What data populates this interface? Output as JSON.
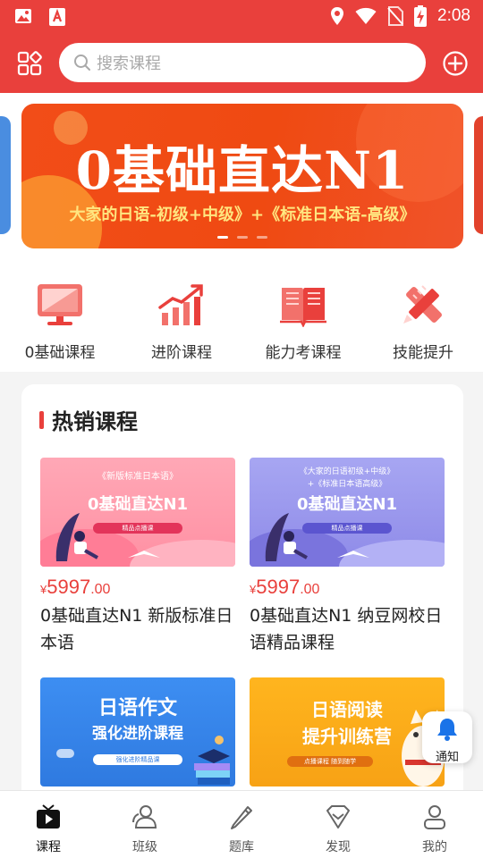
{
  "status_bar": {
    "time": "2:08"
  },
  "header": {
    "search_placeholder": "搜索课程",
    "brand_color": "#e9403c"
  },
  "banner": {
    "title": "0基础直达N1",
    "subtitle": "大家的日语-初级+中级》+《标准日本语-高级》",
    "pages": 3,
    "active_page": 1
  },
  "categories": [
    {
      "label": "0基础课程",
      "icon": "monitor-icon"
    },
    {
      "label": "进阶课程",
      "icon": "growth-chart-icon"
    },
    {
      "label": "能力考课程",
      "icon": "open-book-icon"
    },
    {
      "label": "技能提升",
      "icon": "pencil-ruler-icon"
    }
  ],
  "hot": {
    "title": "热销课程",
    "courses": [
      {
        "thumb_top": "《新版标准日本语》",
        "thumb_title": "0基础直达N1",
        "thumb_pill": "精品点播课",
        "price_currency": "¥",
        "price_int": "5997",
        "price_dec": ".00",
        "name": "0基础直达N1 新版标准日本语"
      },
      {
        "thumb_top": "《大家的日语初级+中级》",
        "thumb_top2": "+《标准日本语高级》",
        "thumb_title": "0基础直达N1",
        "thumb_pill": "精品点播课",
        "price_currency": "¥",
        "price_int": "5997",
        "price_dec": ".00",
        "name": "0基础直达N1 纳豆网校日语精品课程"
      },
      {
        "thumb_title": "日语作文",
        "thumb_title2": "强化进阶课程",
        "thumb_pill": "强化进阶精品课"
      },
      {
        "thumb_title": "日语阅读",
        "thumb_title2": "提升训练营",
        "thumb_pill": "点播课程 随到随学"
      }
    ]
  },
  "notice": {
    "label": "通知"
  },
  "bottom_nav": [
    {
      "label": "课程",
      "icon": "tv-icon",
      "active": true
    },
    {
      "label": "班级",
      "icon": "people-icon",
      "active": false
    },
    {
      "label": "题库",
      "icon": "pencil-icon",
      "active": false
    },
    {
      "label": "发现",
      "icon": "diamond-icon",
      "active": false
    },
    {
      "label": "我的",
      "icon": "person-icon",
      "active": false
    }
  ]
}
